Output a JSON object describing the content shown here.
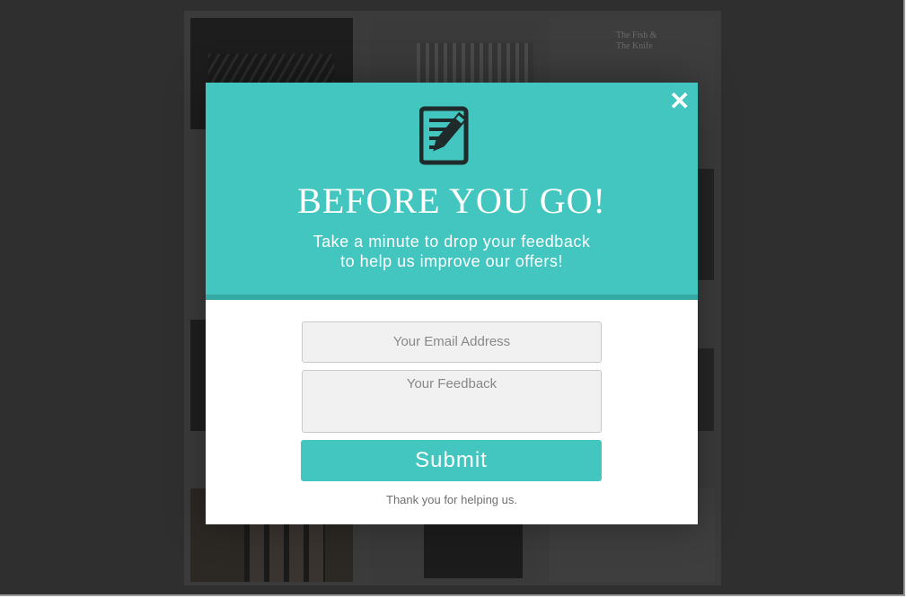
{
  "background": {
    "thumbnail_text": "The Fish & The Knife"
  },
  "modal": {
    "close_symbol": "✕",
    "icon": "edit-document-icon",
    "title": "BEFORE YOU GO!",
    "subtitle_line1": "Take a minute to drop your feedback",
    "subtitle_line2": "to help us improve our offers!",
    "email_placeholder": "Your Email Address",
    "feedback_placeholder": "Your Feedback",
    "submit_label": "Submit",
    "thanks_text": "Thank you for helping us."
  },
  "colors": {
    "accent": "#43c6bf",
    "accent_dark": "#35a9a3",
    "overlay": "#2f2f2f"
  }
}
